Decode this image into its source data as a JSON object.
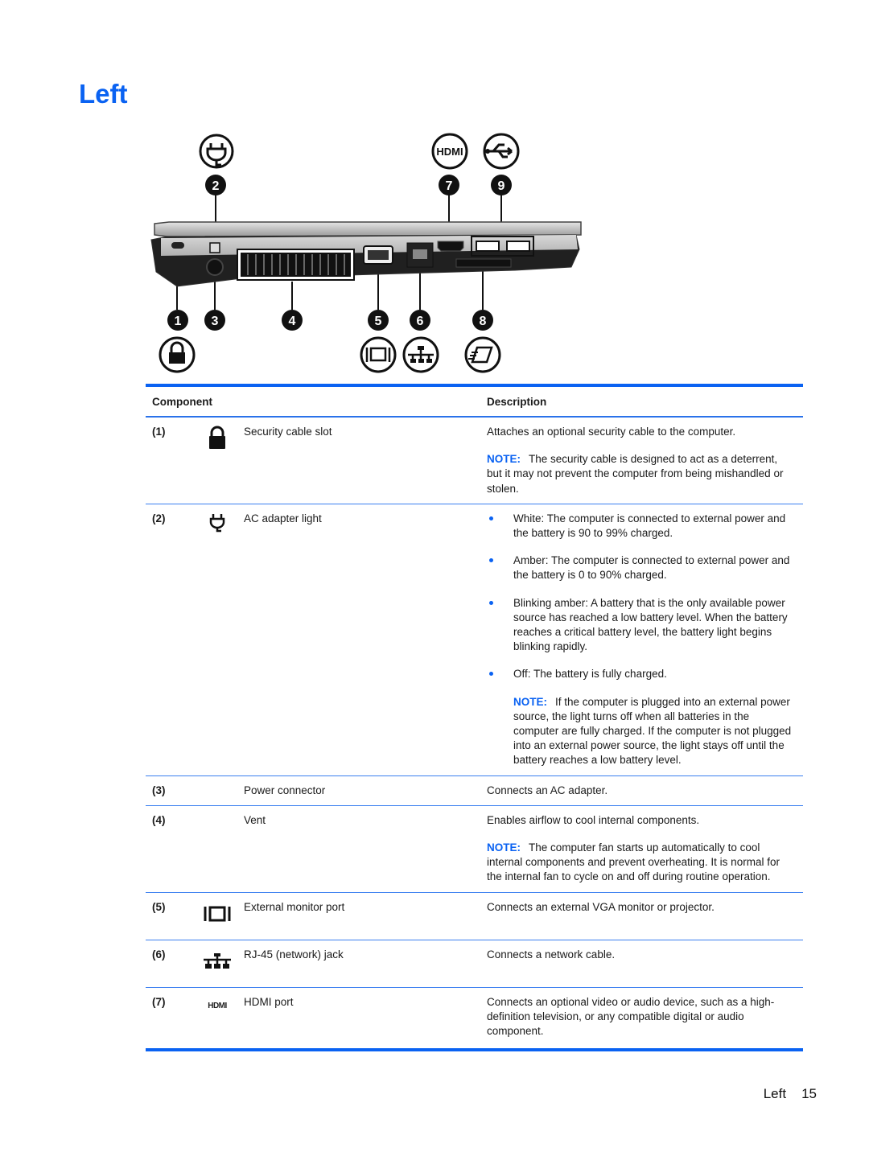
{
  "page": {
    "title": "Left",
    "footer": {
      "section": "Left",
      "page_number": "15"
    }
  },
  "illustration": {
    "callouts": [
      "1",
      "2",
      "3",
      "4",
      "5",
      "6",
      "7",
      "8",
      "9"
    ],
    "top_icons": [
      "ac-adapter-icon",
      "hdmi-icon",
      "usb-icon"
    ],
    "bottom_icons": [
      "lock-icon",
      "monitor-icon",
      "network-icon",
      "media-card-icon"
    ],
    "hdmi_icon_text": "HDMI"
  },
  "table": {
    "headers": {
      "component": "Component",
      "description": "Description"
    },
    "note_label": "NOTE:",
    "rows": [
      {
        "number": "(1)",
        "icon": "lock-icon",
        "name": "Security cable slot",
        "description": "Attaches an optional security cable to the computer.",
        "note": "The security cable is designed to act as a deterrent, but it may not prevent the computer from being mishandled or stolen."
      },
      {
        "number": "(2)",
        "icon": "ac-adapter-icon",
        "name": "AC adapter light",
        "bullets": [
          "White: The computer is connected to external power and the battery is 90 to 99% charged.",
          "Amber: The computer is connected to external power and the battery is 0 to 90% charged.",
          "Blinking amber: A battery that is the only available power source has reached a low battery level. When the battery reaches a critical battery level, the battery light begins blinking rapidly.",
          "Off: The battery is fully charged."
        ],
        "note": "If the computer is plugged into an external power source, the light turns off when all batteries in the computer are fully charged. If the computer is not plugged into an external power source, the light stays off until the battery reaches a low battery level."
      },
      {
        "number": "(3)",
        "icon": "",
        "name": "Power connector",
        "description": "Connects an AC adapter."
      },
      {
        "number": "(4)",
        "icon": "",
        "name": "Vent",
        "description": "Enables airflow to cool internal components.",
        "note": "The computer fan starts up automatically to cool internal components and prevent overheating. It is normal for the internal fan to cycle on and off during routine operation."
      },
      {
        "number": "(5)",
        "icon": "monitor-icon",
        "name": "External monitor port",
        "description": "Connects an external VGA monitor or projector."
      },
      {
        "number": "(6)",
        "icon": "network-icon",
        "name": "RJ-45 (network) jack",
        "description": "Connects a network cable."
      },
      {
        "number": "(7)",
        "icon": "hdmi-icon",
        "icon_text": "HDMI",
        "name": "HDMI port",
        "description": "Connects an optional video or audio device, such as a high-definition television, or any compatible digital or audio component."
      }
    ]
  },
  "colors": {
    "accent": "#0a62f2",
    "text": "#1a1a1a",
    "rule": "#3b7ff0"
  }
}
